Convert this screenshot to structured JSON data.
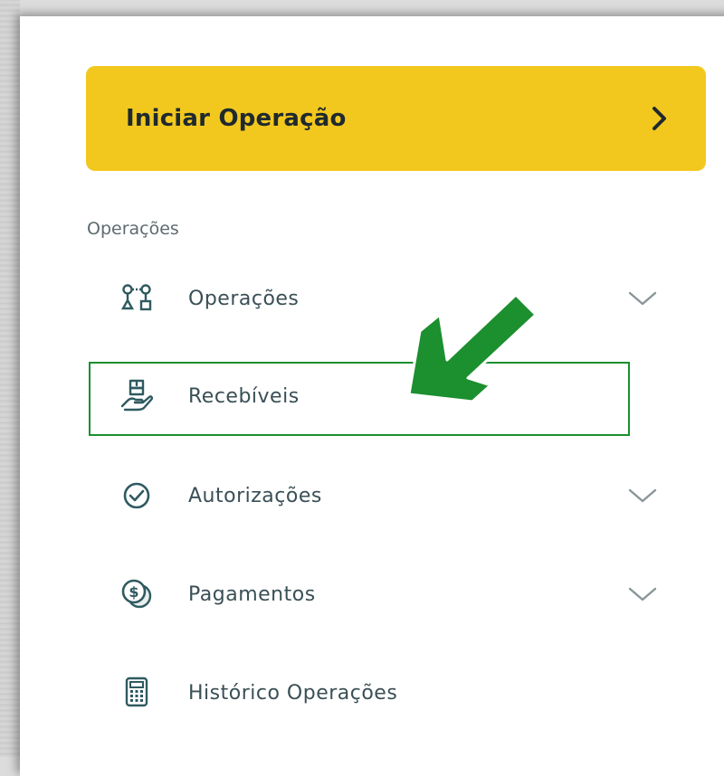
{
  "cta": {
    "label": "Iniciar Operação",
    "icon": "chevron-right-icon",
    "color": "#f3c81e"
  },
  "section": {
    "title": "Operações"
  },
  "menu": [
    {
      "label": "Operações",
      "icon": "workflow-icon",
      "expandable": true
    },
    {
      "label": "Recebíveis",
      "icon": "receivables-hand-icon",
      "expandable": false,
      "highlighted": true
    },
    {
      "label": "Autorizações",
      "icon": "check-circle-icon",
      "expandable": true
    },
    {
      "label": "Pagamentos",
      "icon": "dollar-coin-icon",
      "expandable": true
    },
    {
      "label": "Histórico Operações",
      "icon": "calculator-icon",
      "expandable": false
    }
  ],
  "annotation": {
    "type": "arrow",
    "color": "#1c8f2f",
    "points_to": "Recebíveis"
  },
  "colors": {
    "icon": "#2f5a60",
    "text": "#3a4f56",
    "chevron": "#8a9599"
  }
}
